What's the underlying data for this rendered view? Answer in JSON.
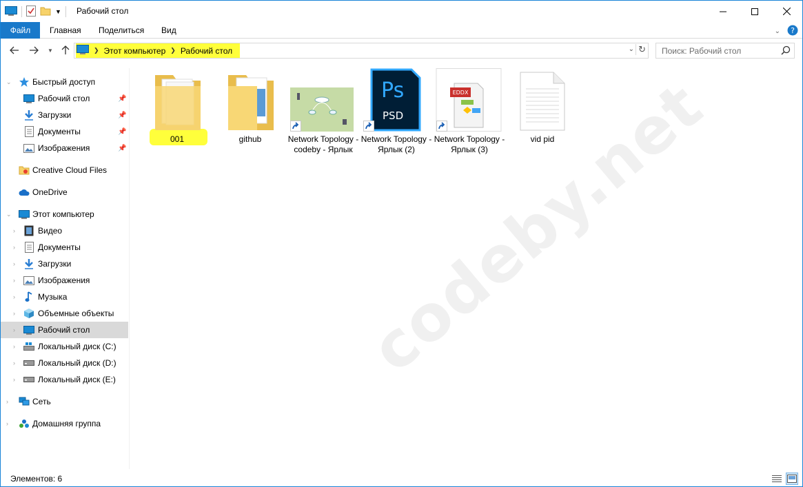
{
  "window": {
    "title": "Рабочий стол"
  },
  "ribbon": {
    "tabs": [
      {
        "label": "Файл"
      },
      {
        "label": "Главная"
      },
      {
        "label": "Поделиться"
      },
      {
        "label": "Вид"
      }
    ]
  },
  "address": {
    "crumbs": [
      "Этот компьютер",
      "Рабочий стол"
    ]
  },
  "search": {
    "placeholder": "Поиск: Рабочий стол"
  },
  "sidebar": {
    "quick_access": {
      "label": "Быстрый доступ",
      "items": [
        {
          "label": "Рабочий стол",
          "icon": "desktop-icon"
        },
        {
          "label": "Загрузки",
          "icon": "download-icon"
        },
        {
          "label": "Документы",
          "icon": "document-icon"
        },
        {
          "label": "Изображения",
          "icon": "pictures-icon"
        }
      ]
    },
    "creative_cloud": {
      "label": "Creative Cloud Files"
    },
    "onedrive": {
      "label": "OneDrive"
    },
    "this_pc": {
      "label": "Этот компьютер",
      "items": [
        {
          "label": "Видео",
          "icon": "video-icon"
        },
        {
          "label": "Документы",
          "icon": "document-icon"
        },
        {
          "label": "Загрузки",
          "icon": "download-icon"
        },
        {
          "label": "Изображения",
          "icon": "pictures-icon"
        },
        {
          "label": "Музыка",
          "icon": "music-icon"
        },
        {
          "label": "Объемные объекты",
          "icon": "3d-objects-icon"
        },
        {
          "label": "Рабочий стол",
          "icon": "desktop-icon"
        },
        {
          "label": "Локальный диск (C:)",
          "icon": "drive-icon"
        },
        {
          "label": "Локальный диск (D:)",
          "icon": "drive-icon"
        },
        {
          "label": "Локальный диск (E:)",
          "icon": "drive-icon"
        }
      ]
    },
    "network": {
      "label": "Сеть"
    },
    "homegroup": {
      "label": "Домашняя группа"
    }
  },
  "files": [
    {
      "name": "001",
      "type": "folder"
    },
    {
      "name": "github",
      "type": "folder"
    },
    {
      "name": "Network Topology - codeby - Ярлык",
      "type": "shortcut-image"
    },
    {
      "name": "Network Topology - Ярлык (2)",
      "type": "shortcut-psd",
      "badge": "PSD"
    },
    {
      "name": "Network Topology - Ярлык (3)",
      "type": "shortcut-eddx",
      "badge": "EDDX"
    },
    {
      "name": "vid pid",
      "type": "text"
    }
  ],
  "watermark": "codeby.net",
  "status": {
    "items_count": "Элементов: 6"
  },
  "colors": {
    "accent": "#1979ca",
    "highlight": "#ffff3b",
    "selected": "#d9d9d9"
  }
}
